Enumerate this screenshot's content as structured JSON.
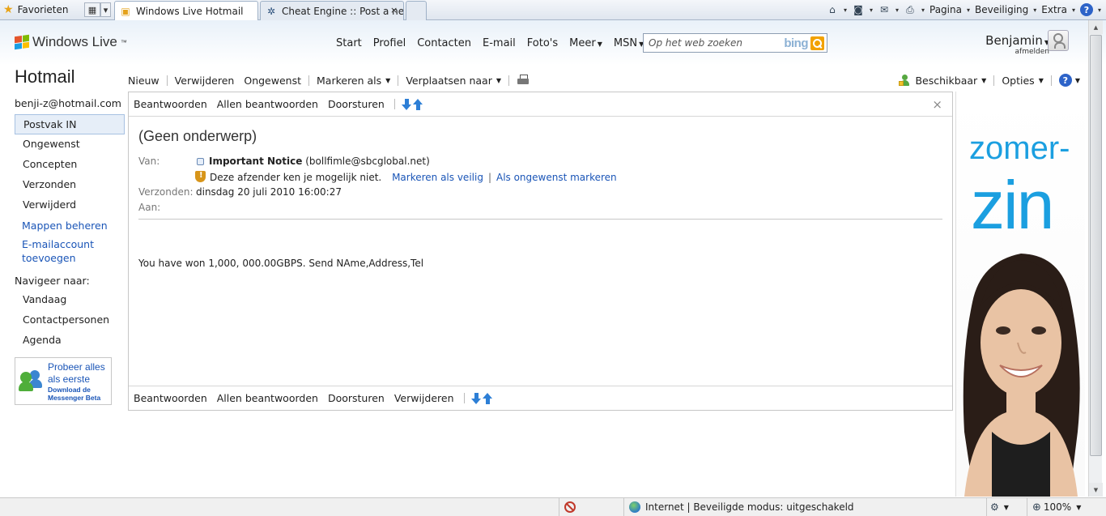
{
  "browser": {
    "favorites_label": "Favorieten",
    "tabs": [
      {
        "label": "Windows Live Hotmail",
        "active": true
      },
      {
        "label": "Cheat Engine :: Post a new...",
        "active": false
      }
    ],
    "menu": {
      "page": "Pagina",
      "security": "Beveiliging",
      "extra": "Extra"
    }
  },
  "header": {
    "brand": "Windows Live",
    "brand_tm": "™",
    "nav": [
      "Start",
      "Profiel",
      "Contacten",
      "E-mail",
      "Foto's",
      "Meer",
      "MSN"
    ],
    "search_placeholder": "Op het web zoeken",
    "search_brand": "bing",
    "user_name": "Benjamin",
    "sign_out": "afmelden"
  },
  "sidebar": {
    "title": "Hotmail",
    "account": "benji-z@hotmail.com",
    "folders": [
      "Postvak IN",
      "Ongewenst",
      "Concepten",
      "Verzonden",
      "Verwijderd"
    ],
    "manage_folders": "Mappen beheren",
    "add_account_line1": "E-mailaccount",
    "add_account_line2": "toevoegen",
    "navigate_label": "Navigeer naar:",
    "navigate_items": [
      "Vandaag",
      "Contactpersonen",
      "Agenda"
    ],
    "promo_line1": "Probeer alles",
    "promo_line2": "als eerste",
    "promo_line3": "Download de",
    "promo_line4": "Messenger Beta"
  },
  "toolbar": {
    "new": "Nieuw",
    "delete": "Verwijderen",
    "junk": "Ongewenst",
    "mark_as": "Markeren als",
    "move_to": "Verplaatsen naar",
    "availability": "Beschikbaar",
    "options": "Opties"
  },
  "message": {
    "actions": {
      "reply": "Beantwoorden",
      "reply_all": "Allen beantwoorden",
      "forward": "Doorsturen",
      "delete": "Verwijderen"
    },
    "subject": "(Geen onderwerp)",
    "from_label": "Van:",
    "from_name": "Important Notice",
    "from_email": "(bollfimle@sbcglobal.net)",
    "warning": "Deze afzender ken je mogelijk niet.",
    "mark_safe": "Markeren als veilig",
    "mark_junk": "Als ongewenst markeren",
    "sent_label": "Verzonden:",
    "sent_value": "dinsdag 20 juli 2010 16:00:27",
    "to_label": "Aan:",
    "body": "You have won 1,000, 000.00GBPS. Send NAme,Address,Tel"
  },
  "ad": {
    "line1": "zomer-",
    "line2": "zin"
  },
  "status_bar": {
    "zone": "Internet | Beveiligde modus: uitgeschakeld",
    "zoom": "100%"
  },
  "colors": {
    "link": "#1a55b7",
    "ad_blue": "#1b9fe0",
    "selected_bg": "#e6eef8"
  }
}
